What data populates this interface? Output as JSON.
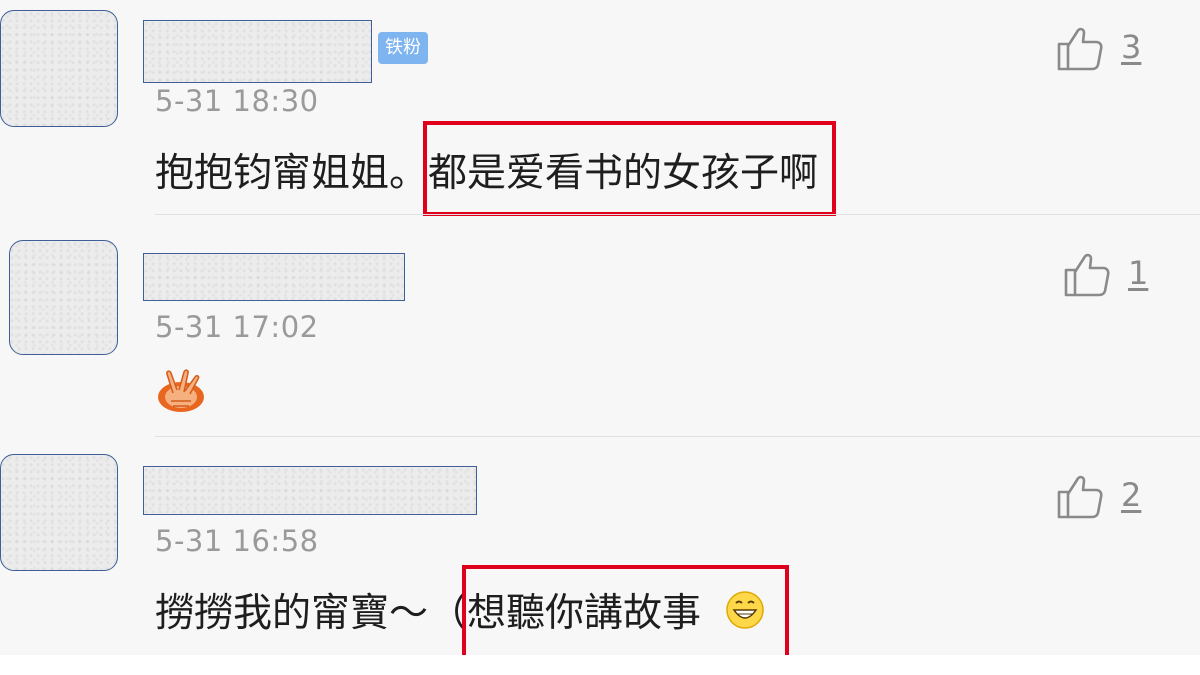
{
  "comments": [
    {
      "badge": "铁粉",
      "time": "5-31 18:30",
      "text_before": "抱抱钧甯姐姐。",
      "text_highlight": "都是爱看书的女孩子啊",
      "likes": "3"
    },
    {
      "time": "5-31 17:02",
      "emoji": "peace-hands-emoji",
      "likes": "1"
    },
    {
      "time": "5-31 16:58",
      "text_before": "撈撈我的甯寶～（",
      "text_highlight": "想聽你講故事",
      "emoji": "grin-emoji",
      "likes": "2"
    }
  ],
  "colors": {
    "highlight_box": "#e0001c",
    "badge": "#7eb4ef",
    "time_text": "#9a9a9a"
  }
}
